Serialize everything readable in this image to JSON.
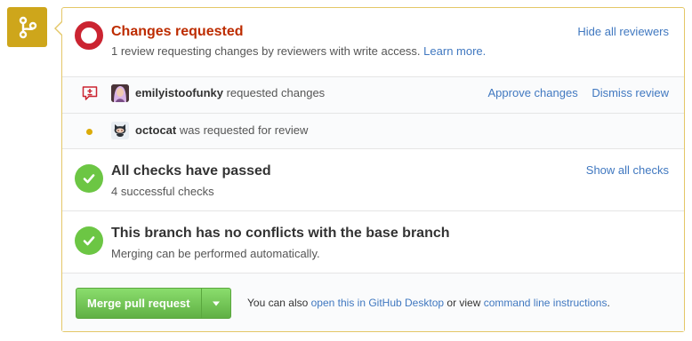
{
  "branch_icon": "git-branch-icon",
  "review": {
    "title": "Changes requested",
    "subtitle": "1 review requesting changes by reviewers with write access.",
    "learn_more": "Learn more.",
    "hide_reviewers": "Hide all reviewers",
    "status_color": "#cb2431"
  },
  "reviewer": {
    "name": "emilyistoofunky",
    "action": "requested changes",
    "approve": "Approve changes",
    "dismiss": "Dismiss review"
  },
  "requested": {
    "name": "octocat",
    "text": "was requested for review"
  },
  "checks": {
    "title": "All checks have passed",
    "subtitle": "4 successful checks",
    "show_all": "Show all checks",
    "status_color": "#6cc644"
  },
  "conflicts": {
    "title": "This branch has no conflicts with the base branch",
    "subtitle": "Merging can be performed automatically."
  },
  "merge": {
    "button": "Merge pull request",
    "text_prefix": "You can also",
    "desktop_link": "open this in GitHub Desktop",
    "text_middle": "or view",
    "cli_link": "command line instructions",
    "text_suffix": "."
  }
}
